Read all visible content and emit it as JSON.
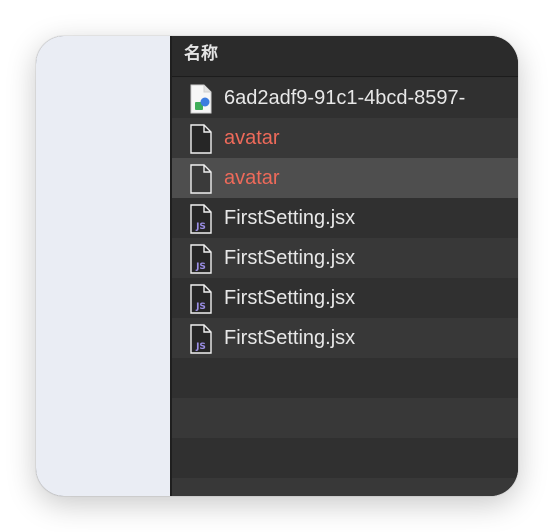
{
  "header": {
    "column_name": "名称"
  },
  "files": [
    {
      "name": "6ad2adf9-91c1-4bcd-8597-",
      "icon": "image-file-icon",
      "label_color": "default",
      "selected": false
    },
    {
      "name": "avatar",
      "icon": "blank-file-icon",
      "label_color": "#ee6a5a",
      "selected": false
    },
    {
      "name": "avatar",
      "icon": "blank-file-icon",
      "label_color": "#ee6a5a",
      "selected": true
    },
    {
      "name": "FirstSetting.jsx",
      "icon": "jsx-file-icon",
      "label_color": "default",
      "selected": false
    },
    {
      "name": "FirstSetting.jsx",
      "icon": "jsx-file-icon",
      "label_color": "default",
      "selected": false
    },
    {
      "name": "FirstSetting.jsx",
      "icon": "jsx-file-icon",
      "label_color": "default",
      "selected": false
    },
    {
      "name": "FirstSetting.jsx",
      "icon": "jsx-file-icon",
      "label_color": "default",
      "selected": false
    }
  ],
  "icon_text": {
    "jsx_badge": "JS"
  },
  "colors": {
    "sidebar_bg": "#eaedf4",
    "list_bg": "#2f2f2f",
    "row_alt_bg": "#383838",
    "selected_bg": "#4e4e4e",
    "red_label": "#ee6a5a",
    "jsx_badge": "#9b8fe6"
  }
}
